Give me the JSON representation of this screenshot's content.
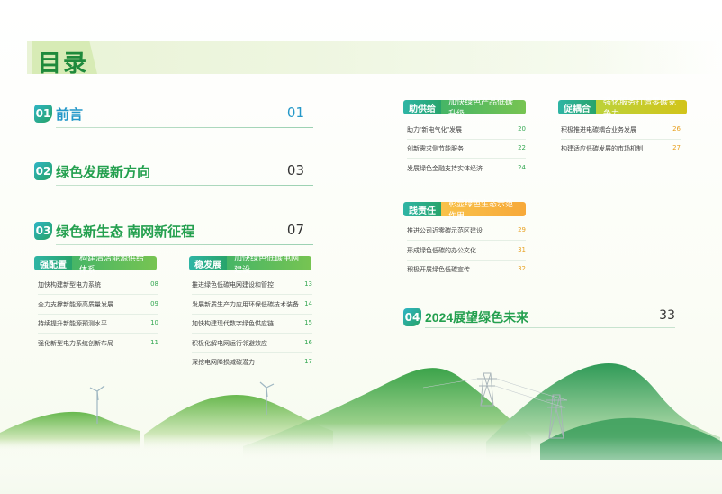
{
  "title": "目录",
  "sections": [
    {
      "num": "01",
      "label": "前言",
      "page": "01"
    },
    {
      "num": "02",
      "label": "绿色发展新方向",
      "page": "03"
    },
    {
      "num": "03",
      "label": "绿色新生态 南网新征程",
      "page": "07"
    },
    {
      "num": "04",
      "label": "2024展望绿色未来",
      "page": "33"
    }
  ],
  "groups": {
    "qiangpeizhi": {
      "tag": "强配置",
      "desc": "构建清洁能源供给体系",
      "items": [
        {
          "text": "加快构建新型电力系统",
          "page": "08"
        },
        {
          "text": "全力支撑新能源高质量发展",
          "page": "09"
        },
        {
          "text": "持续提升新能源预测水平",
          "page": "10"
        },
        {
          "text": "强化新型电力系统创新布局",
          "page": "11"
        }
      ]
    },
    "wenfazhan": {
      "tag": "稳发展",
      "desc": "加快绿色低碳电网建设",
      "items": [
        {
          "text": "推进绿色低碳电网建设和管控",
          "page": "13"
        },
        {
          "text": "发展新质生产力应用环保低碳技术装备",
          "page": "14"
        },
        {
          "text": "加快构建现代数字绿色供应链",
          "page": "15"
        },
        {
          "text": "积极化解电网运行邻避效应",
          "page": "16"
        },
        {
          "text": "深挖电网降损减碳潜力",
          "page": "17"
        }
      ]
    },
    "zhugongji": {
      "tag": "助供给",
      "desc": "加快绿色产品低碳升级",
      "items": [
        {
          "text": "助力\"新电气化\"发展",
          "page": "20"
        },
        {
          "text": "创新需求侧节能服务",
          "page": "22"
        },
        {
          "text": "发展绿色金融支持实体经济",
          "page": "24"
        }
      ]
    },
    "cuouhe": {
      "tag": "促耦合",
      "desc": "强化服务打造零碳竞争力",
      "items": [
        {
          "text": "积极推进电碳耦合业务发展",
          "page": "26"
        },
        {
          "text": "构建适应低碳发展的市场机制",
          "page": "27"
        }
      ]
    },
    "jianzeren": {
      "tag": "践责任",
      "desc": "彰显绿色生态示范作用",
      "items": [
        {
          "text": "推进公司近零碳示范区建设",
          "page": "29"
        },
        {
          "text": "形成绿色低碳的办公文化",
          "page": "31"
        },
        {
          "text": "积极开展绿色低碳宣传",
          "page": "32"
        }
      ]
    }
  },
  "colors": {
    "primary_green": "#24a04f",
    "blue": "#2598c9",
    "accent_orange": "#f7a93a",
    "accent_yellow": "#d2c41a"
  }
}
